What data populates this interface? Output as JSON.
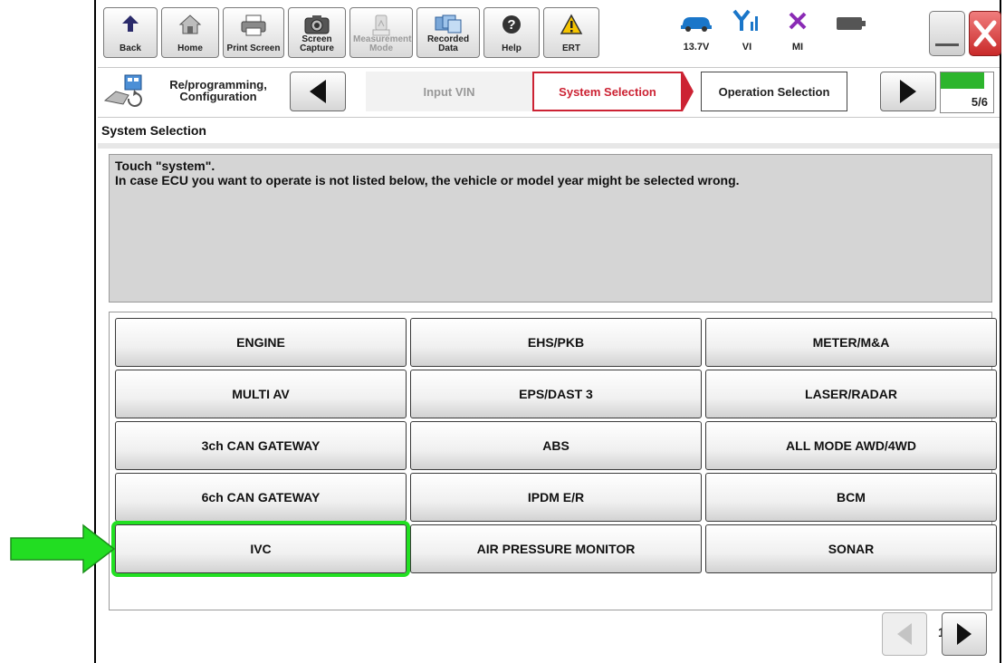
{
  "toolbar": {
    "buttons": [
      {
        "label": "Back",
        "icon": "back-arrow-icon"
      },
      {
        "label": "Home",
        "icon": "home-icon"
      },
      {
        "label": "Print Screen",
        "icon": "printer-icon"
      },
      {
        "label": "Screen Capture",
        "icon": "camera-icon"
      },
      {
        "label": "Measurement Mode",
        "icon": "meter-icon",
        "disabled": true
      },
      {
        "label": "Recorded Data",
        "icon": "recorded-data-icon"
      },
      {
        "label": "Help",
        "icon": "help-icon"
      },
      {
        "label": "ERT",
        "icon": "warning-icon"
      }
    ],
    "status": {
      "voltage": "13.7V",
      "vi": "VI",
      "mi": "MI"
    }
  },
  "stepbar": {
    "section_label": "Re/programming, Configuration",
    "steps": [
      {
        "label": "Input VIN",
        "state": "inactive"
      },
      {
        "label": "System Selection",
        "state": "active"
      },
      {
        "label": "Operation Selection",
        "state": "next"
      }
    ],
    "progress_text": "5/6",
    "progress_fraction": 0.8333
  },
  "page": {
    "title": "System Selection",
    "message_line1": "Touch \"system\".",
    "message_line2": "In case ECU you want to operate is not listed below, the vehicle or model year might be selected wrong."
  },
  "systems": [
    "ENGINE",
    "EHS/PKB",
    "METER/M&A",
    "MULTI AV",
    "EPS/DAST 3",
    "LASER/RADAR",
    "3ch CAN GATEWAY",
    "ABS",
    "ALL MODE AWD/4WD",
    "6ch CAN GATEWAY",
    "IPDM E/R",
    "BCM",
    "IVC",
    "AIR PRESSURE MONITOR",
    "SONAR"
  ],
  "highlighted_system": "IVC",
  "pager": {
    "text": "1/2"
  },
  "colors": {
    "active_step": "#cc2233",
    "highlight": "#22e022",
    "progress": "#2db52d"
  }
}
